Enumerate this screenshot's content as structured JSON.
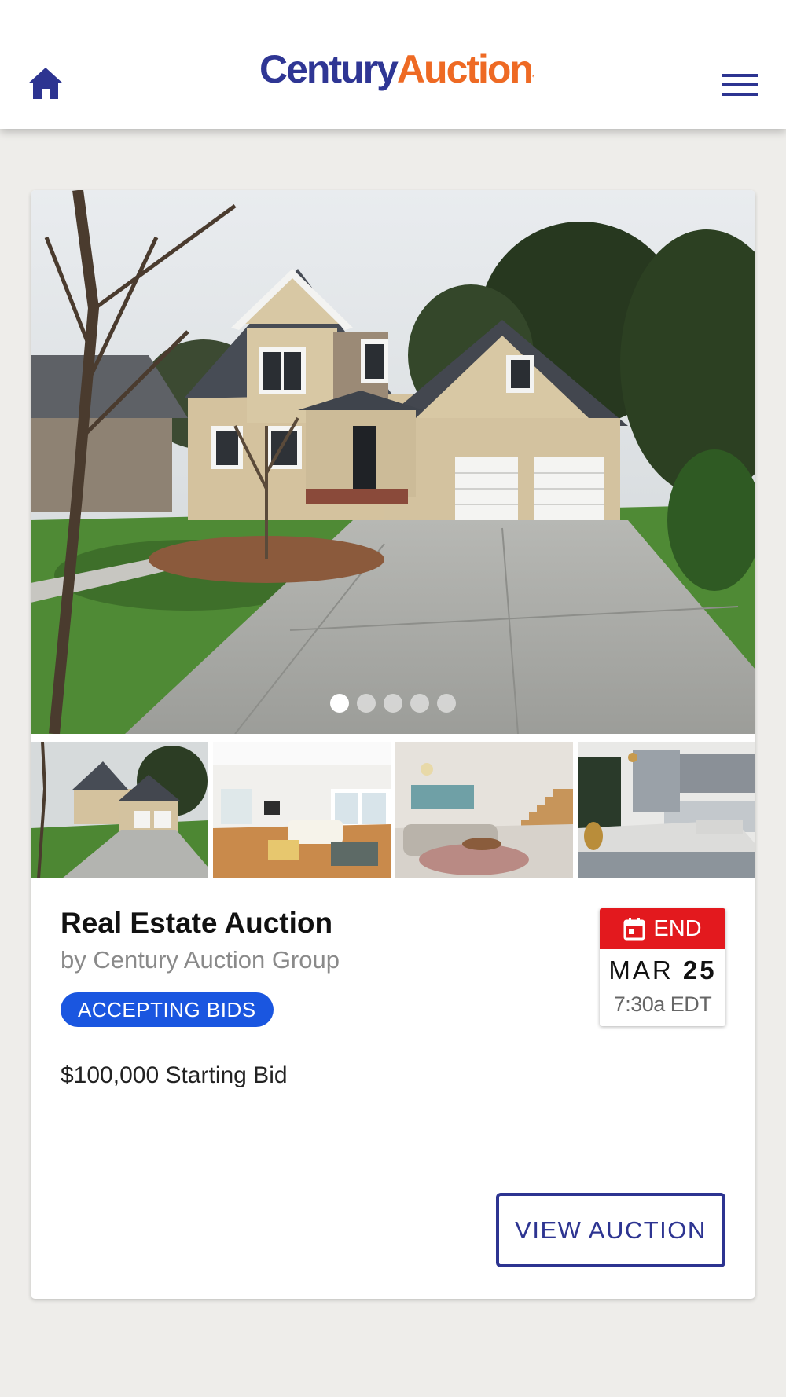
{
  "header": {
    "logo": {
      "part1": "Century",
      "part2": "Auction"
    },
    "home_icon": "home-icon",
    "menu_icon": "hamburger-menu-icon"
  },
  "gallery": {
    "slide_count": 5,
    "active_slide": 1,
    "thumbnails": [
      "house-exterior",
      "living-room",
      "lounge-staircase",
      "kitchen"
    ]
  },
  "listing": {
    "title": "Real Estate Auction",
    "byline": "by Century Auction Group",
    "status_badge": "ACCEPTING BIDS",
    "price_text": "$100,000 Starting Bid",
    "end": {
      "label": "END",
      "month": "MAR",
      "day": "25",
      "time": "7:30a EDT",
      "icon": "calendar-icon"
    },
    "cta_label": "VIEW AUCTION"
  },
  "colors": {
    "brand_navy": "#2d3491",
    "brand_orange": "#ee6a24",
    "badge_blue": "#1a56e0",
    "end_red": "#e3191e",
    "page_bg": "#eeedea"
  }
}
